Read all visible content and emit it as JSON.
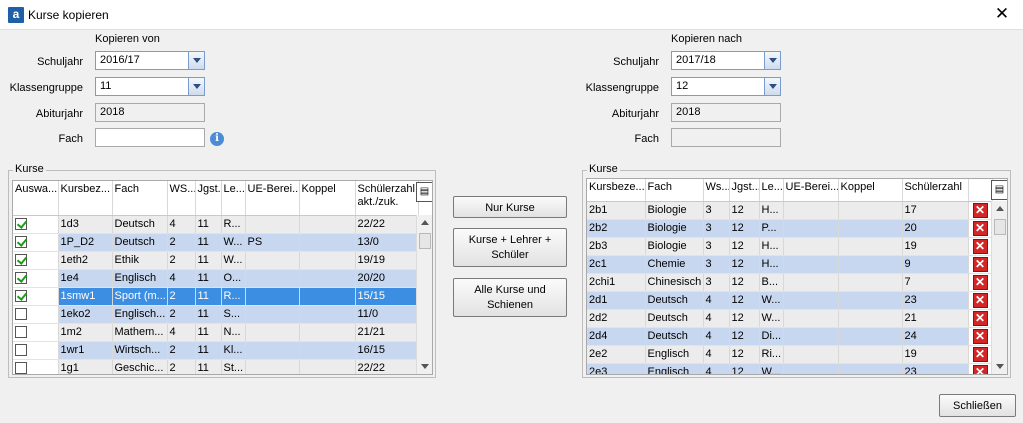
{
  "window": {
    "app_icon": "a",
    "title": "Kurse kopieren",
    "close": "✕"
  },
  "source": {
    "header": "Kopieren von",
    "schuljahr_label": "Schuljahr",
    "schuljahr": "2016/17",
    "klassengruppe_label": "Klassengruppe",
    "klassengruppe": "11",
    "abiturjahr_label": "Abiturjahr",
    "abiturjahr": "2018",
    "fach_label": "Fach",
    "fach": "",
    "info_icon": "info-icon"
  },
  "target": {
    "header": "Kopieren nach",
    "schuljahr_label": "Schuljahr",
    "schuljahr": "2017/18",
    "klassengruppe_label": "Klassengruppe",
    "klassengruppe": "12",
    "abiturjahr_label": "Abiturjahr",
    "abiturjahr": "2018",
    "fach_label": "Fach",
    "fach": ""
  },
  "left_grid": {
    "legend": "Kurse",
    "columns": [
      "Auswa...",
      "Kursbez...",
      "Fach",
      "WS...",
      "Jgst...",
      "Le...",
      "UE-Berei...",
      "Koppel",
      "Schülerzahl akt./zuk."
    ],
    "rows": [
      {
        "checked": true,
        "cells": [
          "1d3",
          "Deutsch",
          "4",
          "11",
          "R...",
          "",
          "",
          "22/22"
        ]
      },
      {
        "checked": true,
        "cells": [
          "1P_D2",
          "Deutsch",
          "2",
          "11",
          "W...",
          "PS",
          "",
          "13/0"
        ]
      },
      {
        "checked": true,
        "cells": [
          "1eth2",
          "Ethik",
          "2",
          "11",
          "W...",
          "",
          "",
          "19/19"
        ]
      },
      {
        "checked": true,
        "cells": [
          "1e4",
          "Englisch",
          "4",
          "11",
          "O...",
          "",
          "",
          "20/20"
        ]
      },
      {
        "checked": true,
        "cells": [
          "1smw1",
          "Sport (m...",
          "2",
          "11",
          "R...",
          "",
          "",
          "15/15"
        ]
      },
      {
        "checked": false,
        "cells": [
          "1eko2",
          "Englisch...",
          "2",
          "11",
          "S...",
          "",
          "",
          "11/0"
        ]
      },
      {
        "checked": false,
        "cells": [
          "1m2",
          "Mathem...",
          "4",
          "11",
          "N...",
          "",
          "",
          "21/21"
        ]
      },
      {
        "checked": false,
        "cells": [
          "1wr1",
          "Wirtsch...",
          "2",
          "11",
          "Kl...",
          "",
          "",
          "16/15"
        ]
      },
      {
        "checked": false,
        "cells": [
          "1g1",
          "Geschic...",
          "2",
          "11",
          "St...",
          "",
          "",
          "22/22"
        ]
      }
    ]
  },
  "right_grid": {
    "legend": "Kurse",
    "columns": [
      "Kursbeze...",
      "Fach",
      "Ws...",
      "Jgst...",
      "Le...",
      "UE-Berei...",
      "Koppel",
      "Schülerzahl"
    ],
    "rows": [
      [
        "2b1",
        "Biologie",
        "3",
        "12",
        "H...",
        "",
        "",
        "17"
      ],
      [
        "2b2",
        "Biologie",
        "3",
        "12",
        "P...",
        "",
        "",
        "20"
      ],
      [
        "2b3",
        "Biologie",
        "3",
        "12",
        "H...",
        "",
        "",
        "19"
      ],
      [
        "2c1",
        "Chemie",
        "3",
        "12",
        "H...",
        "",
        "",
        "9"
      ],
      [
        "2chi1",
        "Chinesisch",
        "3",
        "12",
        "B...",
        "",
        "",
        "7"
      ],
      [
        "2d1",
        "Deutsch",
        "4",
        "12",
        "W...",
        "",
        "",
        "23"
      ],
      [
        "2d2",
        "Deutsch",
        "4",
        "12",
        "W...",
        "",
        "",
        "21"
      ],
      [
        "2d4",
        "Deutsch",
        "4",
        "12",
        "Di...",
        "",
        "",
        "24"
      ],
      [
        "2e2",
        "Englisch",
        "4",
        "12",
        "Ri...",
        "",
        "",
        "19"
      ],
      [
        "2e3",
        "Englisch",
        "4",
        "12",
        "W...",
        "",
        "",
        "23"
      ]
    ]
  },
  "buttons": {
    "nur_kurse": "Nur Kurse",
    "kurse_lehrer": "Kurse + Lehrer + Schüler",
    "alle_kurse": "Alle Kurse und Schienen",
    "schliessen": "Schließen"
  }
}
